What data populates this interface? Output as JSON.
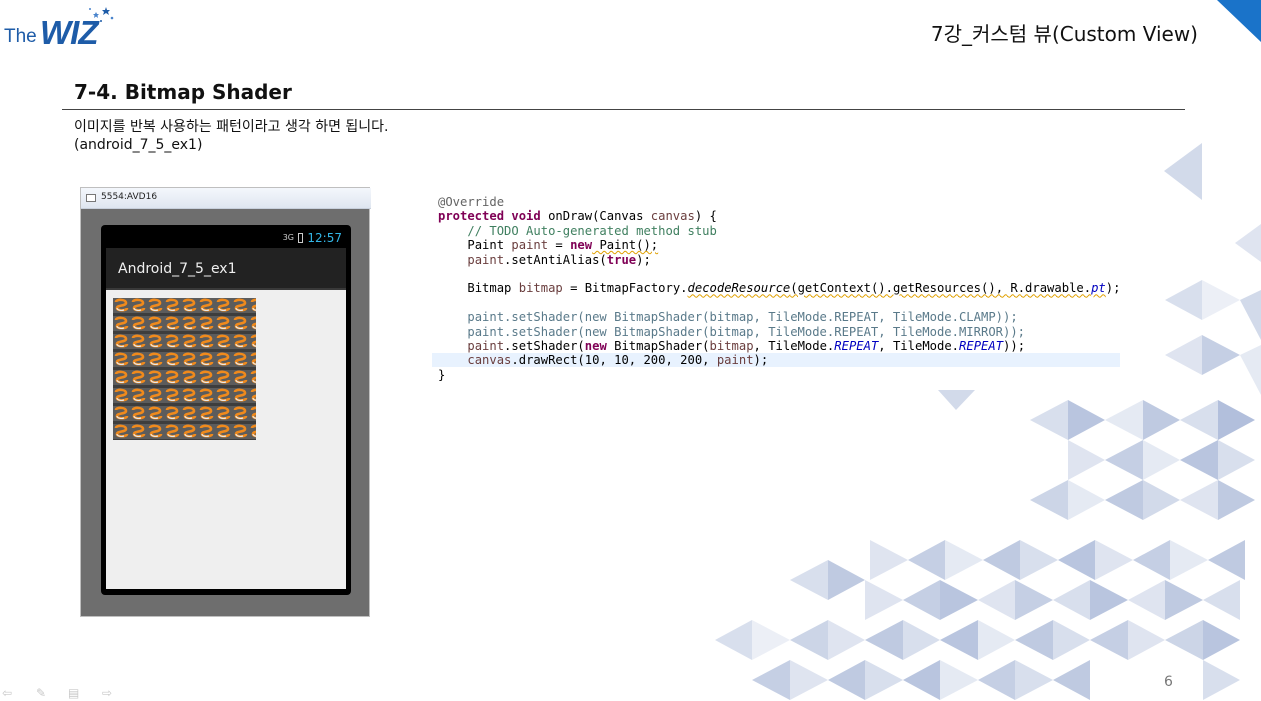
{
  "logo": {
    "the": "The",
    "wiz": "WIZ"
  },
  "header": {
    "chapter_title": "7강_커스텀 뷰(Custom View)"
  },
  "section": {
    "title": "7-4. Bitmap Shader",
    "desc_line1": "이미지를 반복 사용하는 패턴이라고 생각 하면 됩니다.",
    "desc_line2": "(android_7_5_ex1)"
  },
  "emulator": {
    "window_title": "5554:AVD16",
    "signal": "3G",
    "clock": "12:57",
    "app_title": "Android_7_5_ex1"
  },
  "code": {
    "annotation": "@Override",
    "l2_kw": "protected void ",
    "l2_rest": "onDraw(Canvas ",
    "l2_var": "canvas",
    "l2_end": ") {",
    "l3": "// TODO Auto-generated method stub",
    "l4_type": "Paint ",
    "l4_var": "paint",
    "l4_eq": " = ",
    "l4_kw": "new",
    "l4_end": " Paint();",
    "l5_var": "paint",
    "l5_mid": ".setAntiAlias(",
    "l5_kw": "true",
    "l5_end": ");",
    "l7_type": "Bitmap ",
    "l7_var": "bitmap",
    "l7_mid": " = BitmapFactory.",
    "l7_it": "decodeResource",
    "l7_args": "(getContext().getResources(), R.drawable.",
    "l7_fld": "pt",
    "l7_end": ");",
    "l9": "paint.setShader(new BitmapShader(bitmap, TileMode.REPEAT, TileMode.CLAMP));",
    "l10": "paint.setShader(new BitmapShader(bitmap, TileMode.REPEAT, TileMode.MIRROR));",
    "l11_var": "paint",
    "l11_mid": ".setShader(",
    "l11_kw": "new",
    "l11_mid2": " BitmapShader(",
    "l11_var2": "bitmap",
    "l11_mid3": ", TileMode.",
    "l11_fld1": "REPEAT",
    "l11_mid4": ", TileMode.",
    "l11_fld2": "REPEAT",
    "l11_end": "));",
    "l12_var": "canvas",
    "l12_mid": ".drawRect(10, 10, 200, 200, ",
    "l12_var2": "paint",
    "l12_end": ");",
    "l13": "}"
  },
  "footer": {
    "page_number": "6"
  },
  "colors": {
    "brand": "#1e5ca8",
    "accent_blue": "#33b5e5",
    "triangle": "#7f95c4"
  }
}
